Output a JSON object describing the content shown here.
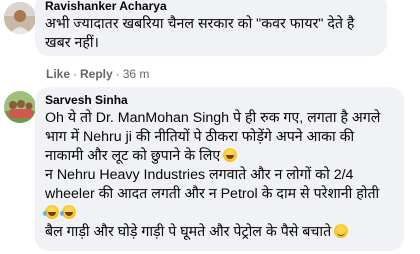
{
  "comments": [
    {
      "author": "Ravishanker Acharya",
      "lines": [
        "अभी ज्यादातर खबरिया चैनल सरकार को \"कवर फायर\" देते है",
        "खबर नहीं।"
      ],
      "actions": {
        "like": "Like",
        "reply": "Reply",
        "time": "36 m"
      }
    },
    {
      "author": "Sarvesh Sinha",
      "lines": [
        "Oh ये तो Dr. ManMohan Singh पे ही रुक गए, लगता है अगले",
        "भाग में Nehru ji की नीतियों पे ठीकरा फोड़ेंगे अपने आका की",
        "नाकामी और लूट को छुपाने के लिए",
        "न Nehru Heavy Industries लगवाते और न लोगों को 2/4",
        "wheeler की आदत लगती और न Petrol के दाम से परेशानी होती",
        "",
        "बैल गाड़ी और घोड़े गाड़ी पे घूमते और पेट्रोल के पैसे बचाते"
      ]
    }
  ],
  "icons": {
    "emoji_laugh": "grinning-sweat-emoji",
    "emoji_joy": "tears-of-joy-emoji",
    "emoji_smile": "smiling-emoji"
  },
  "colors": {
    "bubble": "#f0f2f5",
    "meta_text": "#65676b"
  }
}
